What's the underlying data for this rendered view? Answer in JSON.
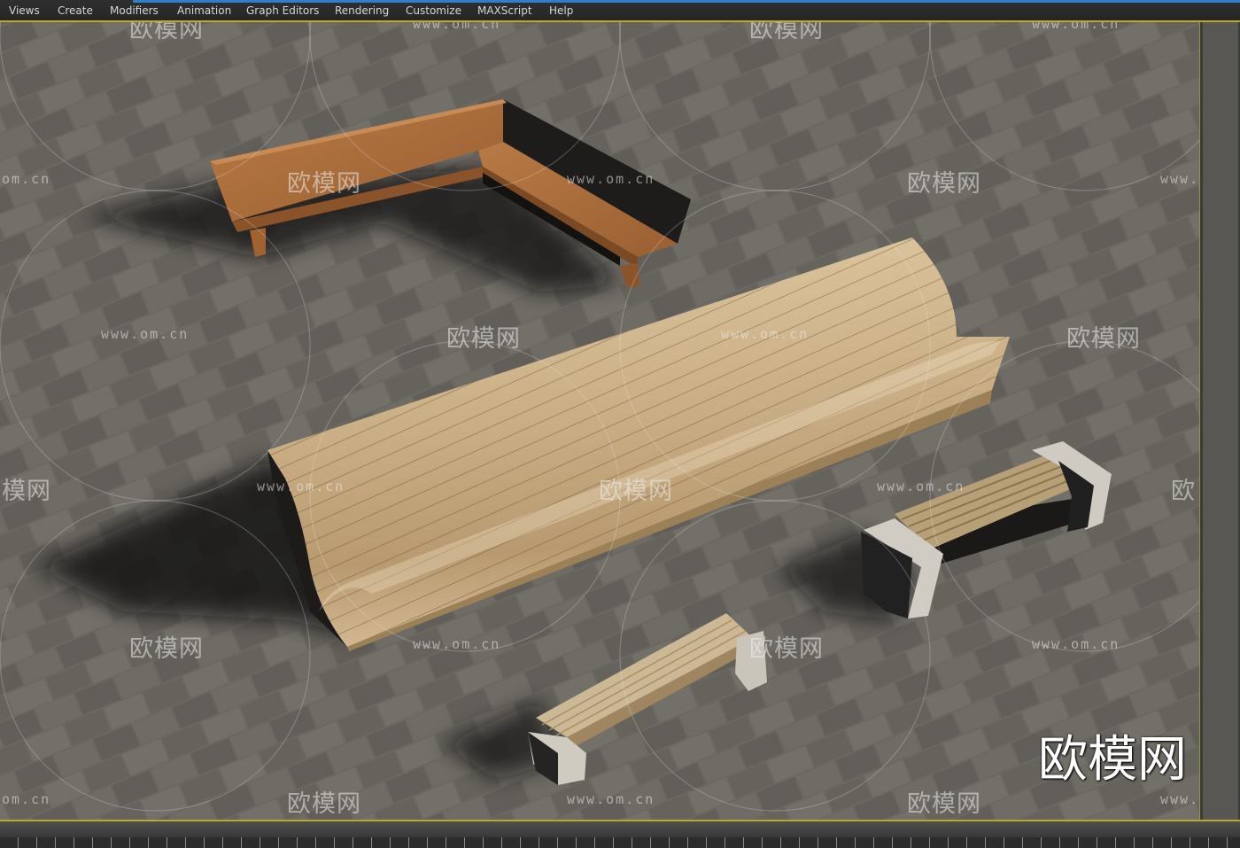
{
  "menu": {
    "views": "Views",
    "create": "Create",
    "modifiers": "Modifiers",
    "animation": "Animation",
    "graph_editors": "Graph Editors",
    "rendering": "Rendering",
    "customize": "Customize",
    "maxscript": "MAXScript",
    "help": "Help"
  },
  "watermark": {
    "url": "www.om.cn",
    "url_cropped_left": "om.cn",
    "url_cropped_right": "www.",
    "cn": "欧模网",
    "cn_cropped_left": "模网",
    "cn_cropped_right": "欧",
    "big": "欧模网"
  },
  "colors": {
    "menubar_bg": "#2b2b2b",
    "viewport_border": "#b9a92a",
    "pavement": "#6c6963",
    "wood_light": "#c9ae86",
    "wood_dark": "#a8683a",
    "concrete": "#c8c4ba"
  }
}
